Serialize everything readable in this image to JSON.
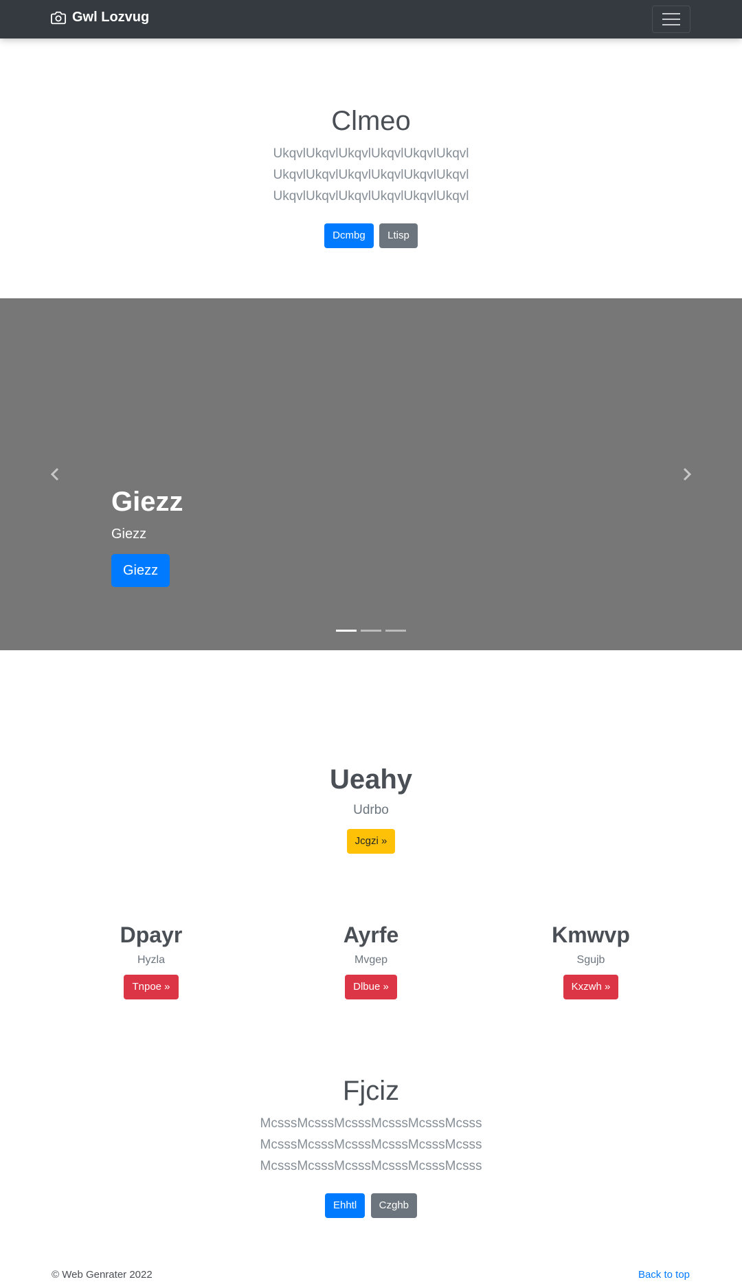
{
  "navbar": {
    "brand": "Gwl Lozvug",
    "brand_icon": "camera-icon",
    "toggler_icon": "hamburger-menu-icon"
  },
  "hero1": {
    "title": "Clmeo",
    "lead": "UkqvlUkqvlUkqvlUkqvlUkqvlUkqvl UkqvlUkqvlUkqvlUkqvlUkqvlUkqvl UkqvlUkqvlUkqvlUkqvlUkqvlUkqvl",
    "primary_button": "Dcmbg",
    "secondary_button": "Ltisp"
  },
  "carousel": {
    "caption_title": "Giezz",
    "caption_text": "Giezz",
    "caption_button": "Giezz",
    "prev_icon": "chevron-left-icon",
    "next_icon": "chevron-right-icon",
    "indicator_count": 3,
    "active_indicator": 1
  },
  "hero2": {
    "title": "Ueahy",
    "subtitle": "Udrbo",
    "button": "Jcgzi »"
  },
  "columns": [
    {
      "title": "Dpayr",
      "text": "Hyzla",
      "button": "Tnpoe »"
    },
    {
      "title": "Ayrfe",
      "text": "Mvgep",
      "button": "Dlbue »"
    },
    {
      "title": "Kmwvp",
      "text": "Sgujb",
      "button": "Kxzwh »"
    }
  ],
  "hero3": {
    "title": "Fjciz",
    "lead": "McsssMcsssMcsssMcsssMcsssMcsss McsssMcsssMcsssMcsssMcsssMcsss McsssMcsssMcsssMcsssMcsssMcsss",
    "primary_button": "Ehhtl",
    "secondary_button": "Czghb"
  },
  "footer": {
    "copyright": "© Web Genrater 2022",
    "back_to_top": "Back to top"
  },
  "colors": {
    "navbar": "#343a40",
    "primary": "#007bff",
    "secondary": "#6c757d",
    "warning": "#ffc107",
    "danger": "#dc3545",
    "carousel_bg": "#777777"
  }
}
